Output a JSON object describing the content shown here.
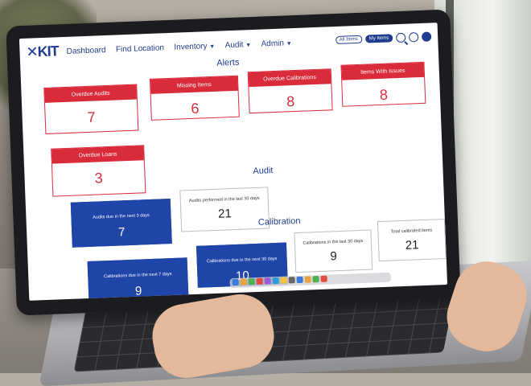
{
  "app": {
    "logo": "KIT",
    "nav": [
      {
        "label": "Dashboard"
      },
      {
        "label": "Find Location"
      },
      {
        "label": "Inventory",
        "has_menu": true
      },
      {
        "label": "Audit",
        "has_menu": true
      },
      {
        "label": "Admin",
        "has_menu": true
      }
    ],
    "toggle": {
      "options": [
        "All Items",
        "My Items"
      ],
      "selected": "My Items"
    },
    "icons": [
      "search-icon",
      "help-icon",
      "user-icon"
    ]
  },
  "colors": {
    "brand": "#1f3c8f",
    "alert": "#d92b3a",
    "tile_blue": "#1f45a8"
  },
  "sections": {
    "alerts": {
      "title": "Alerts",
      "cards": [
        {
          "label": "Overdue Audits",
          "value": "7"
        },
        {
          "label": "Missing Items",
          "value": "6"
        },
        {
          "label": "Overdue Calibrations",
          "value": "8"
        },
        {
          "label": "Items With Issues",
          "value": "8"
        },
        {
          "label": "Overdue Loans",
          "value": "3"
        }
      ]
    },
    "audit": {
      "title": "Audit",
      "cards": [
        {
          "label": "Audits due in the next 3 days",
          "value": "7"
        },
        {
          "label": "Audits performed in the last 30 days",
          "value": "21"
        }
      ]
    },
    "calibration": {
      "title": "Calibration",
      "cards": [
        {
          "label": "Calibrations due in the next 7 days",
          "value": "9"
        },
        {
          "label": "Calibrations due in the next 30 days",
          "value": "10"
        },
        {
          "label": "Calibrations in the last 30 days",
          "value": "9"
        },
        {
          "label": "Total calibrated items",
          "value": "21"
        }
      ]
    }
  }
}
